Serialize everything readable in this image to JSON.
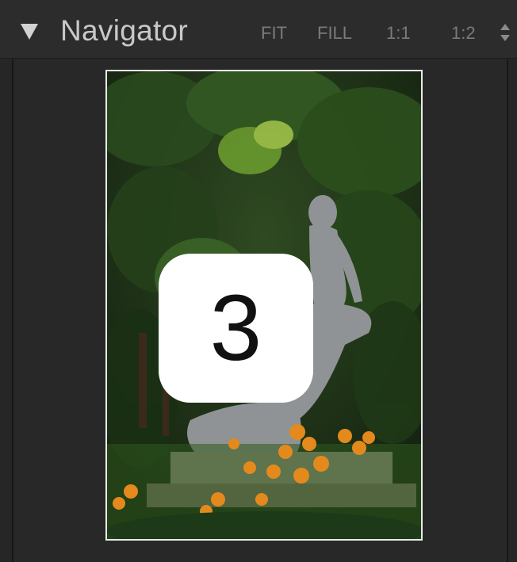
{
  "navigator": {
    "title": "Navigator",
    "zoom_options": [
      "FIT",
      "FILL",
      "1:1",
      "1:2"
    ],
    "collapse_icon": "triangle-down-icon",
    "stepper_icon": "up-down-arrows-icon"
  },
  "preview": {
    "subject": "statue-in-garden",
    "callout_number": "3"
  },
  "colors": {
    "panel_bg": "#262626",
    "header_text": "#c9c9c9",
    "zoom_text": "#7a7a7a",
    "frame_border": "#e9e9e9",
    "callout_bg": "#ffffff"
  }
}
